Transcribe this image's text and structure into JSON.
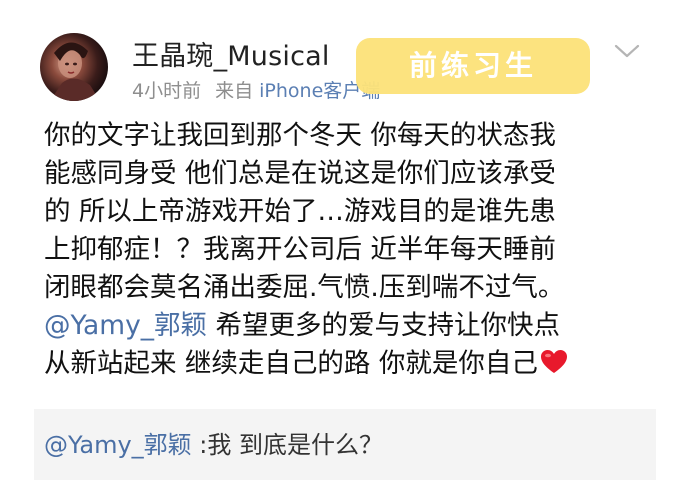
{
  "post": {
    "author": {
      "name": "王晶琬_Musical",
      "avatar_icon": "avatar-photo"
    },
    "time": "4小时前",
    "source_prefix": "来自",
    "source_device": "iPhone客户端",
    "watermark": "前练习生",
    "more_icon": "chevron-down-icon",
    "body_lines": [
      "你的文字让我回到那个冬天 你每天的状态我",
      "能感同身受 他们总是在说这是你们应该承受",
      "的 所以上帝游戏开始了…游戏目的是谁先患",
      "上抑郁症！？我离开公司后 近半年每天睡前",
      "闭眼都会莫名涌出委屈.气愤.压到喘不过气。"
    ],
    "mention_line": {
      "mention": "@Yamy_郭颖",
      "text": " 希望更多的爱与支持让你快点"
    },
    "last_line": "从新站起来 继续走自己的路 你就是你自己",
    "heart_icon": "red-heart-icon"
  },
  "quoted": {
    "mention": "@Yamy_郭颖",
    "text": " :我 到底是什么？"
  },
  "colors": {
    "mention": "#4a6fa5",
    "watermark_bg": "#fce27a",
    "quote_bg": "#f4f4f4",
    "heart": "#e8192c"
  }
}
